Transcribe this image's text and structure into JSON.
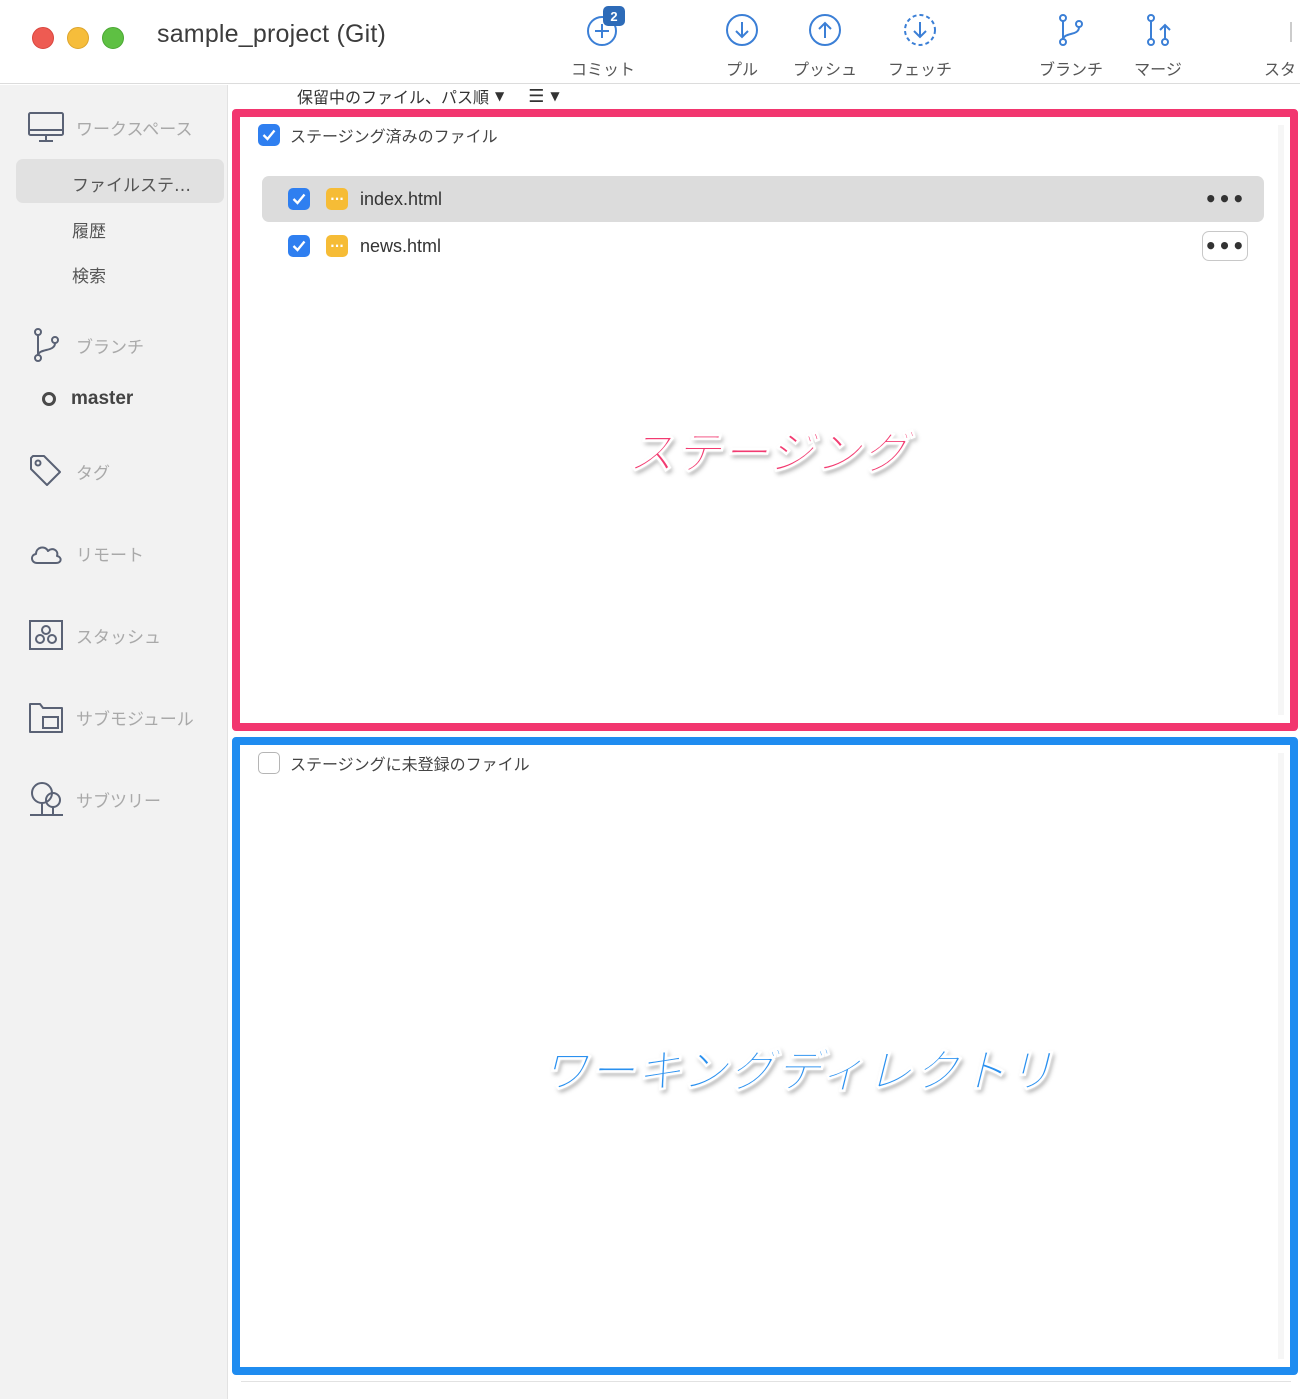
{
  "window": {
    "title": "sample_project (Git)"
  },
  "toolbar": {
    "commit": {
      "label": "コミット",
      "badge": "2",
      "icon": "commit-icon"
    },
    "pull": {
      "label": "プル",
      "icon": "pull-icon"
    },
    "push": {
      "label": "プッシュ",
      "icon": "push-icon"
    },
    "fetch": {
      "label": "フェッチ",
      "icon": "fetch-icon"
    },
    "branch": {
      "label": "ブランチ",
      "icon": "branch-icon"
    },
    "merge": {
      "label": "マージ",
      "icon": "merge-icon"
    },
    "stash": {
      "label": "スタ",
      "icon": "stash-icon"
    }
  },
  "sidebar": {
    "workspace": {
      "label": "ワークスペース",
      "icon": "monitor-icon"
    },
    "workspace_items": [
      "ファイルステ…",
      "履歴",
      "検索"
    ],
    "branches": {
      "label": "ブランチ",
      "icon": "branch-icon"
    },
    "current_branch": "master",
    "tags": {
      "label": "タグ",
      "icon": "tag-icon"
    },
    "remotes": {
      "label": "リモート",
      "icon": "cloud-icon"
    },
    "stashes": {
      "label": "スタッシュ",
      "icon": "stash-icon"
    },
    "submodules": {
      "label": "サブモジュール",
      "icon": "submodule-icon"
    },
    "subtrees": {
      "label": "サブツリー",
      "icon": "tree-icon"
    }
  },
  "filter": {
    "label": "保留中のファイル、パス順",
    "view_icon": "list-icon"
  },
  "staged": {
    "header": "ステージング済みのファイル",
    "checked": true,
    "files": [
      {
        "name": "index.html",
        "status": "modified",
        "selected": true
      },
      {
        "name": "news.html",
        "status": "modified",
        "selected": false
      }
    ],
    "annotation": "ステージング",
    "border_color": "#f2366f"
  },
  "unstaged": {
    "header": "ステージングに未登録のファイル",
    "checked": false,
    "annotation": "ワーキングディレクトリ",
    "border_color": "#1f8cf0"
  },
  "colors": {
    "accent": "#2f7ff0",
    "file_badge": "#f6bc36",
    "toolbar_icon": "#3b7fd6"
  }
}
